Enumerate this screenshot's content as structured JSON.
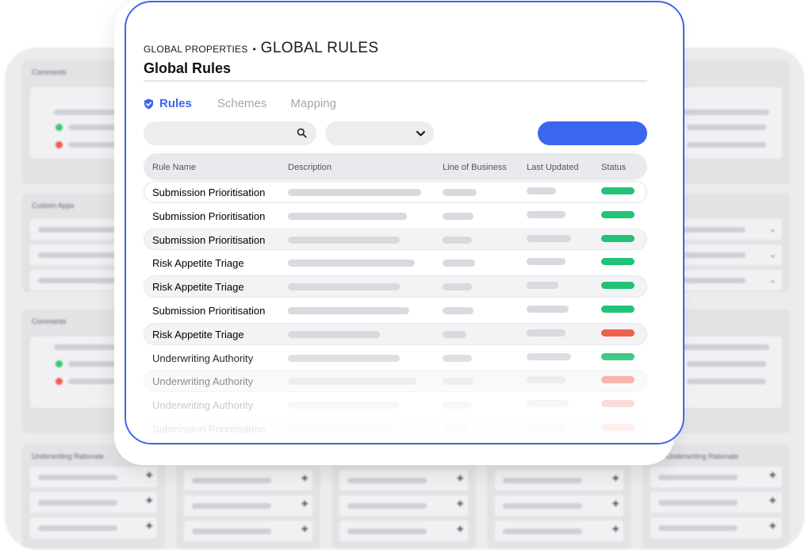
{
  "background": {
    "panel_titles": {
      "comments": "Comments",
      "custom_apps": "Custom Apps",
      "underwriting_rationale": "Underwriting Rationale"
    },
    "colors": {
      "green": "#3cc47a",
      "red": "#f05a4a"
    }
  },
  "breadcrumb": {
    "parent": "GLOBAL PROPERTIES",
    "separator": "•",
    "current": "GLOBAL RULES"
  },
  "page_title": "Global Rules",
  "tabs": [
    {
      "label": "Rules",
      "active": true,
      "icon": "shield-check-icon"
    },
    {
      "label": "Schemes",
      "active": false
    },
    {
      "label": "Mapping",
      "active": false
    }
  ],
  "search": {
    "placeholder": "",
    "icon": "search-icon"
  },
  "filter": {
    "value": "",
    "icon": "chevron-down-icon"
  },
  "primary_button": {
    "label": ""
  },
  "table": {
    "columns": [
      "Rule Name",
      "Description",
      "Line of Business",
      "Last Updated",
      "Status"
    ],
    "rows": [
      {
        "name": "Submission Prioritisation",
        "status": "active",
        "status_color": "#22c277"
      },
      {
        "name": "Submission Prioritisation",
        "status": "active",
        "status_color": "#22c277"
      },
      {
        "name": "Submission Prioritisation",
        "status": "active",
        "status_color": "#22c277"
      },
      {
        "name": "Risk Appetite Triage",
        "status": "active",
        "status_color": "#22c277"
      },
      {
        "name": "Risk Appetite Triage",
        "status": "active",
        "status_color": "#22c277"
      },
      {
        "name": "Submission Prioritisation",
        "status": "active",
        "status_color": "#22c277"
      },
      {
        "name": "Risk Appetite Triage",
        "status": "inactive",
        "status_color": "#f0604e"
      },
      {
        "name": "Underwriting Authority",
        "status": "active",
        "status_color": "#22c277"
      },
      {
        "name": "Underwriting Authority",
        "status": "inactive",
        "status_color": "#f0604e"
      },
      {
        "name": "Underwriting Authority",
        "status": "inactive",
        "status_color": "#f0604e"
      },
      {
        "name": "Submission Prioritisation",
        "status": "inactive",
        "status_color": "#f0604e"
      }
    ]
  },
  "accent_color": "#3b66ee"
}
